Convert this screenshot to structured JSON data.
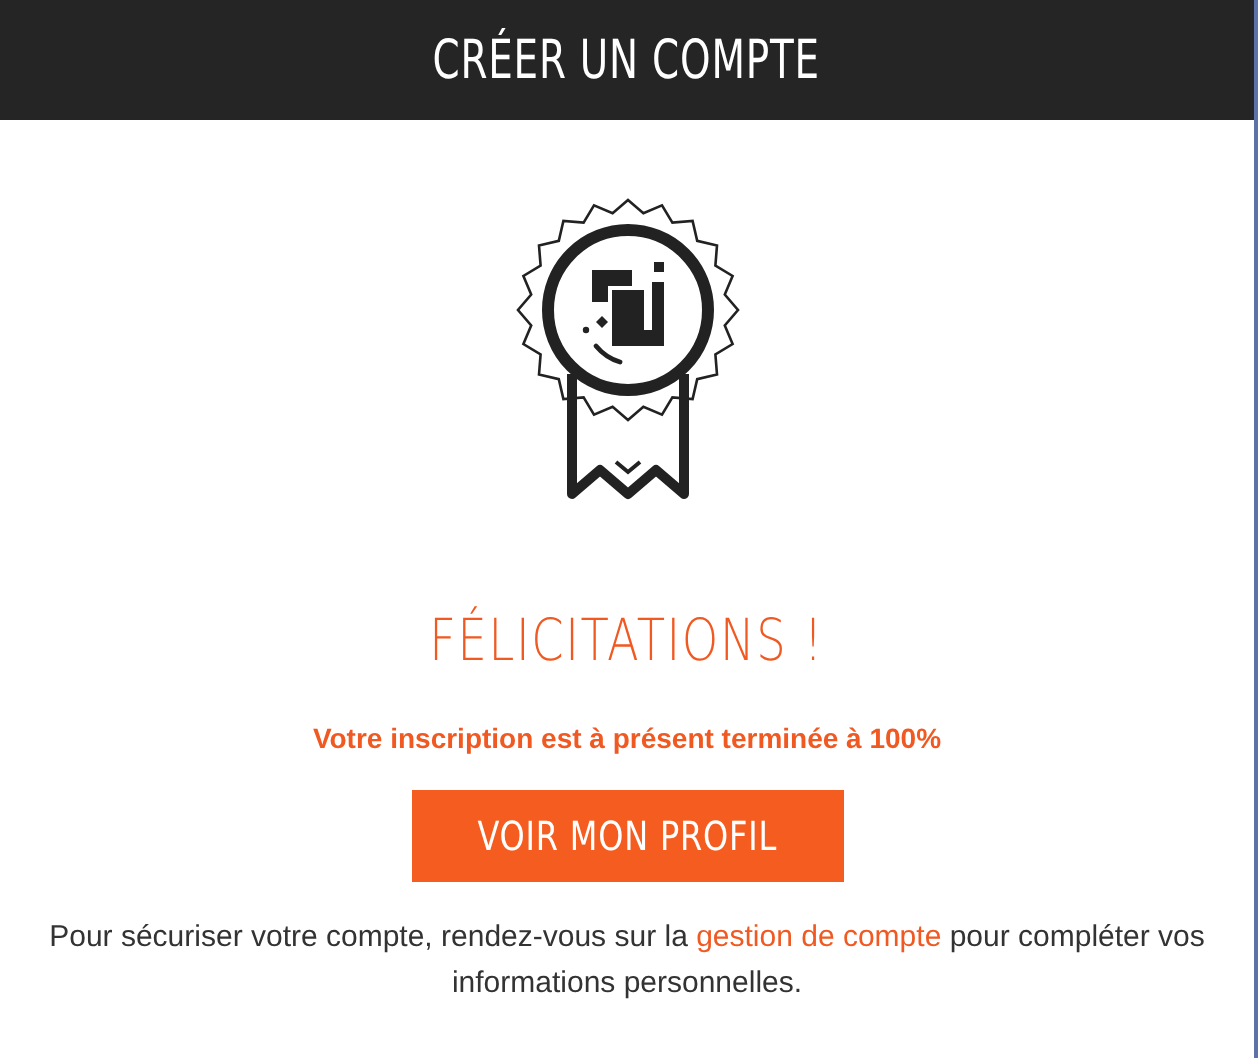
{
  "header": {
    "title": "CRÉER UN COMPTE"
  },
  "message": {
    "title": "FÉLICITATIONS !",
    "subtitle": "Votre inscription est à présent terminée à 100%"
  },
  "button": {
    "label": "VOIR MON PROFIL"
  },
  "note": {
    "before": "Pour sécuriser votre compte, rendez-vous sur la ",
    "link": "gestion de compte",
    "after": " pour compléter vos informations personnelles."
  }
}
